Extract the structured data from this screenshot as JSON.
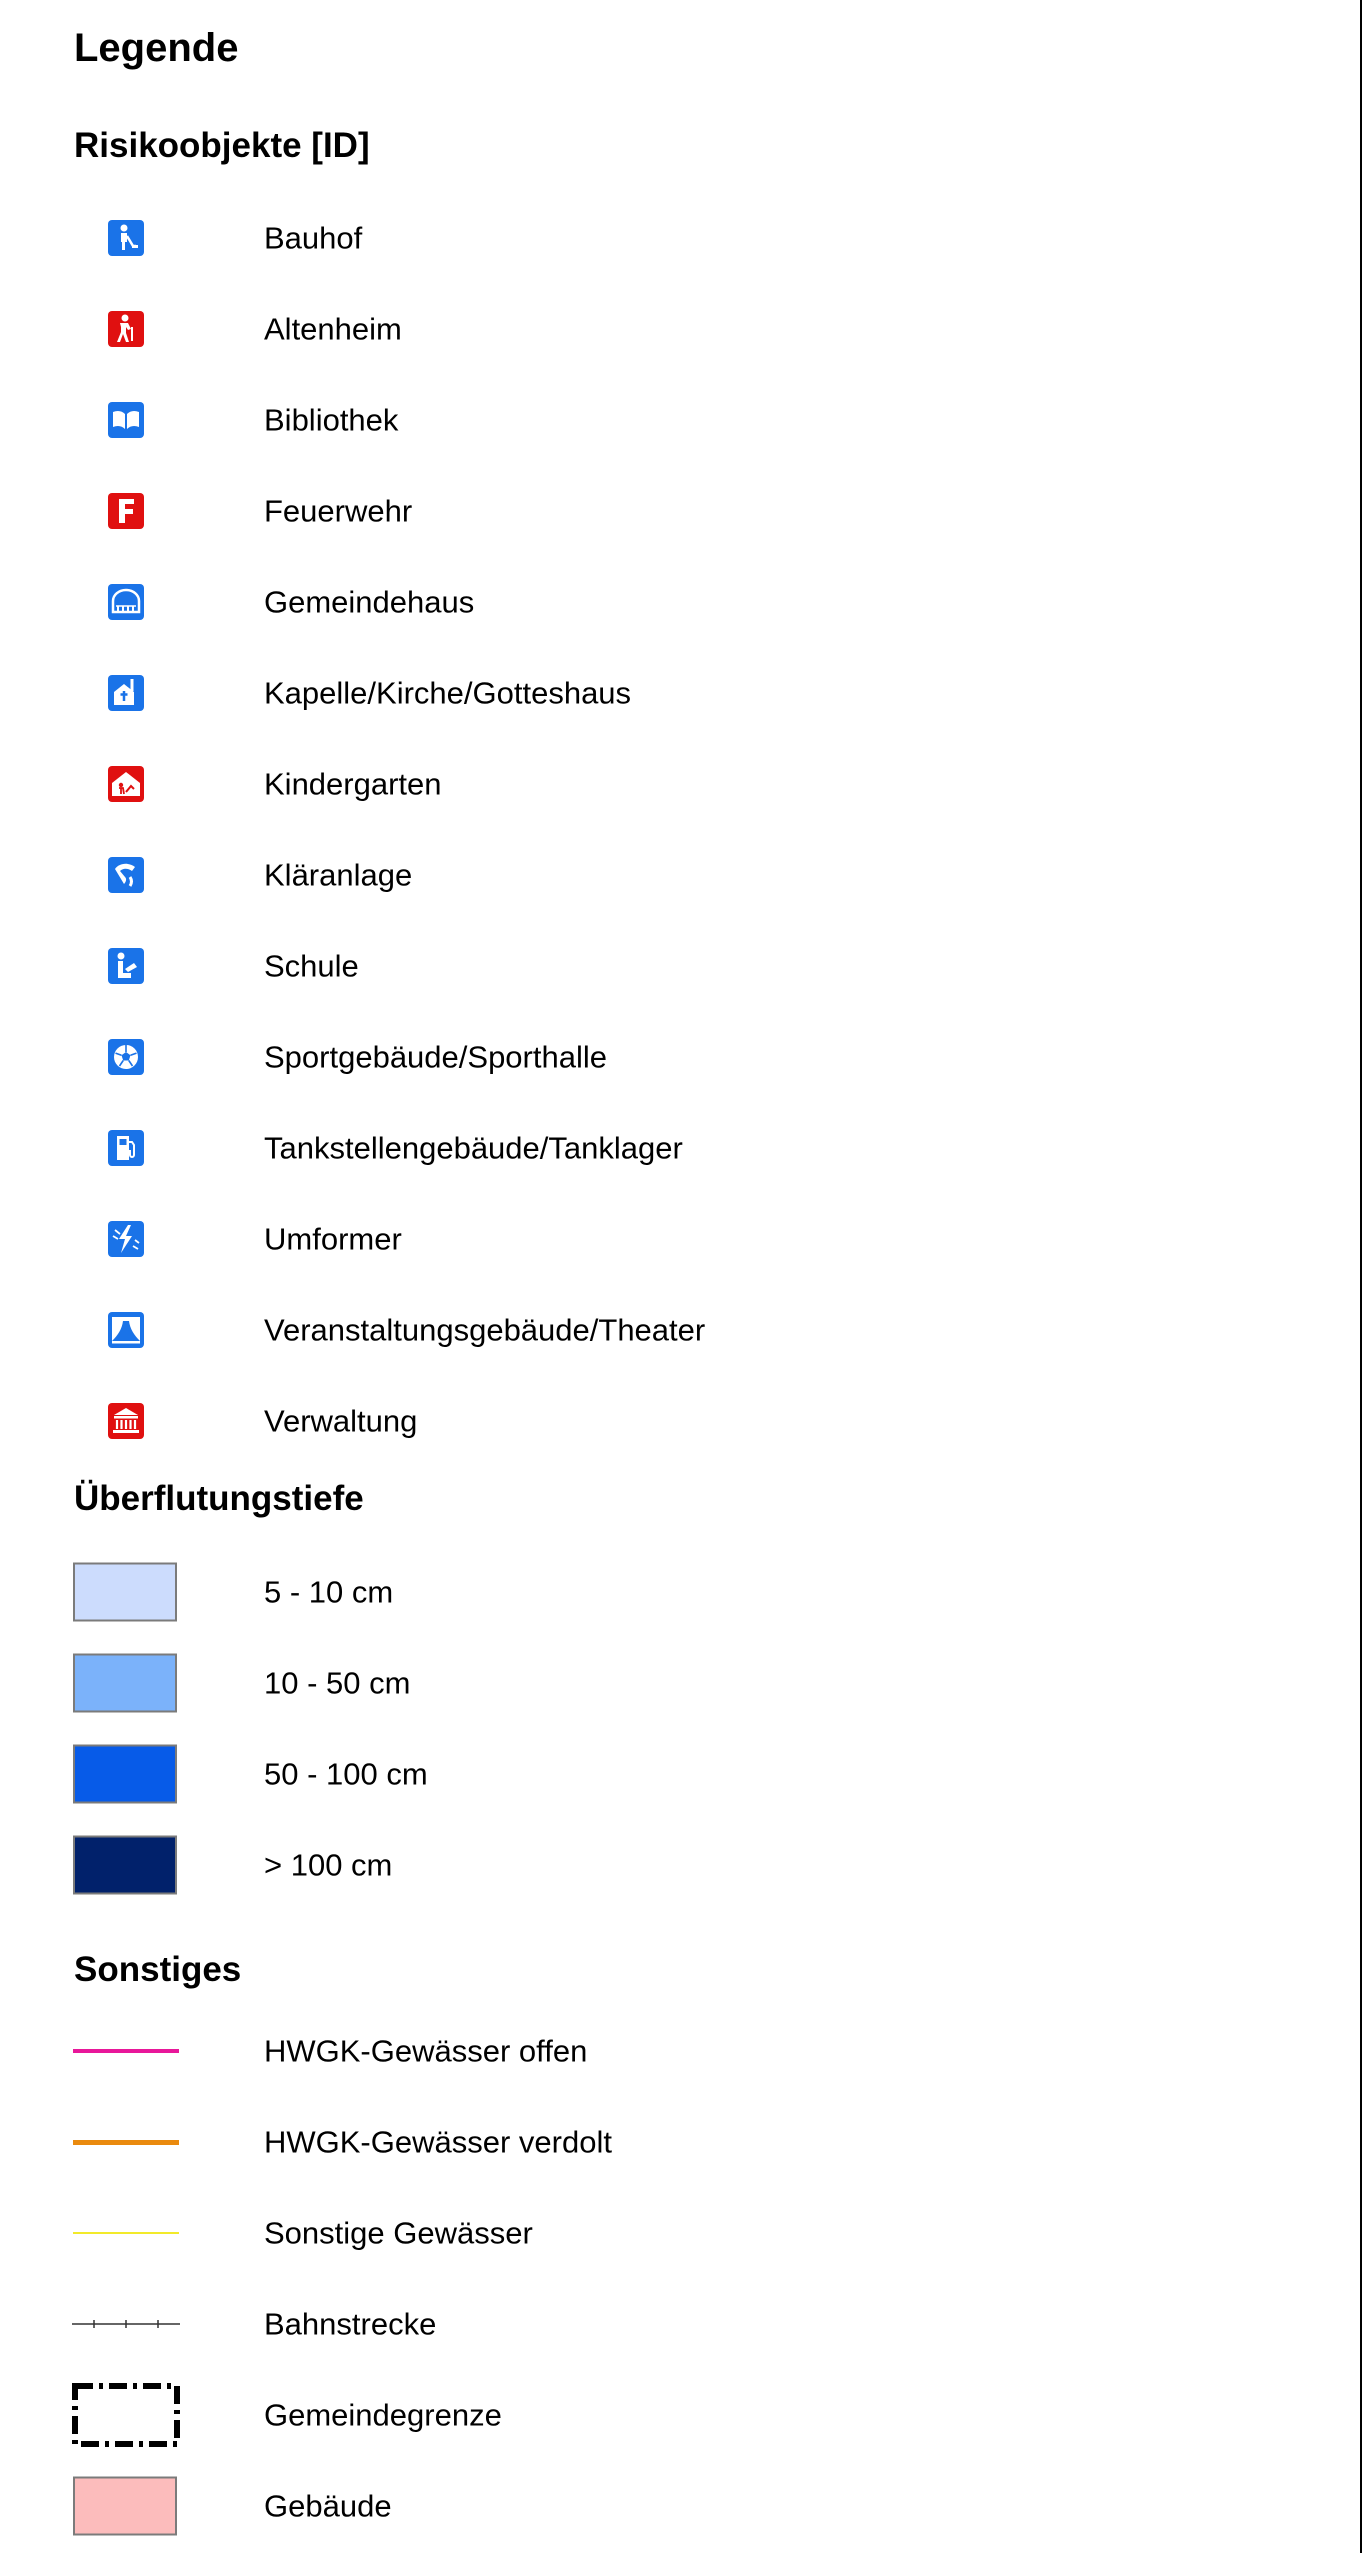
{
  "legend": {
    "title": "Legende",
    "colors": {
      "blue_icon": "#1a73e8",
      "red_icon": "#e01010"
    },
    "risk_objects": {
      "title": "Risikoobjekte [ID]",
      "items": [
        {
          "label": "Bauhof",
          "icon": "construction-worker-icon",
          "color": "#1a73e8"
        },
        {
          "label": "Altenheim",
          "icon": "elderly-person-icon",
          "color": "#e01010"
        },
        {
          "label": "Bibliothek",
          "icon": "open-book-icon",
          "color": "#1a73e8"
        },
        {
          "label": "Feuerwehr",
          "icon": "letter-f-icon",
          "color": "#e01010"
        },
        {
          "label": "Gemeindehaus",
          "icon": "community-hall-icon",
          "color": "#1a73e8"
        },
        {
          "label": "Kapelle/Kirche/Gotteshaus",
          "icon": "chapel-icon",
          "color": "#1a73e8"
        },
        {
          "label": "Kindergarten",
          "icon": "kindergarten-icon",
          "color": "#e01010"
        },
        {
          "label": "Kläranlage",
          "icon": "sewage-plant-icon",
          "color": "#1a73e8"
        },
        {
          "label": "Schule",
          "icon": "school-reader-icon",
          "color": "#1a73e8"
        },
        {
          "label": "Sportgebäude/Sporthalle",
          "icon": "soccer-ball-icon",
          "color": "#1a73e8"
        },
        {
          "label": "Tankstellengebäude/Tanklager",
          "icon": "fuel-pump-icon",
          "color": "#1a73e8"
        },
        {
          "label": "Umformer",
          "icon": "lightning-icon",
          "color": "#1a73e8"
        },
        {
          "label": "Veranstaltungsgebäude/Theater",
          "icon": "theater-curtain-icon",
          "color": "#1a73e8"
        },
        {
          "label": "Verwaltung",
          "icon": "government-building-icon",
          "color": "#e01010"
        }
      ]
    },
    "flood_depth": {
      "title": "Überflutungstiefe",
      "items": [
        {
          "label": "5 - 10 cm",
          "color": "#ccdcfd"
        },
        {
          "label": "10 - 50 cm",
          "color": "#7bb2fa"
        },
        {
          "label": "50 - 100 cm",
          "color": "#075be8"
        },
        {
          "label": "> 100 cm",
          "color": "#01216b"
        }
      ]
    },
    "other": {
      "title": "Sonstiges",
      "items": [
        {
          "label": "HWGK-Gewässer offen",
          "symbol": "line",
          "color": "#e8179a"
        },
        {
          "label": "HWGK-Gewässer verdolt",
          "symbol": "line",
          "color": "#ea8a0e"
        },
        {
          "label": "Sonstige Gewässer",
          "symbol": "line",
          "color": "#f2ea2a"
        },
        {
          "label": "Bahnstrecke",
          "symbol": "railway",
          "color": "#333333"
        },
        {
          "label": "Gemeindegrenze",
          "symbol": "boundary",
          "color": "#000000"
        },
        {
          "label": "Gebäude",
          "symbol": "fill",
          "color": "#fcbcbc"
        }
      ]
    }
  }
}
